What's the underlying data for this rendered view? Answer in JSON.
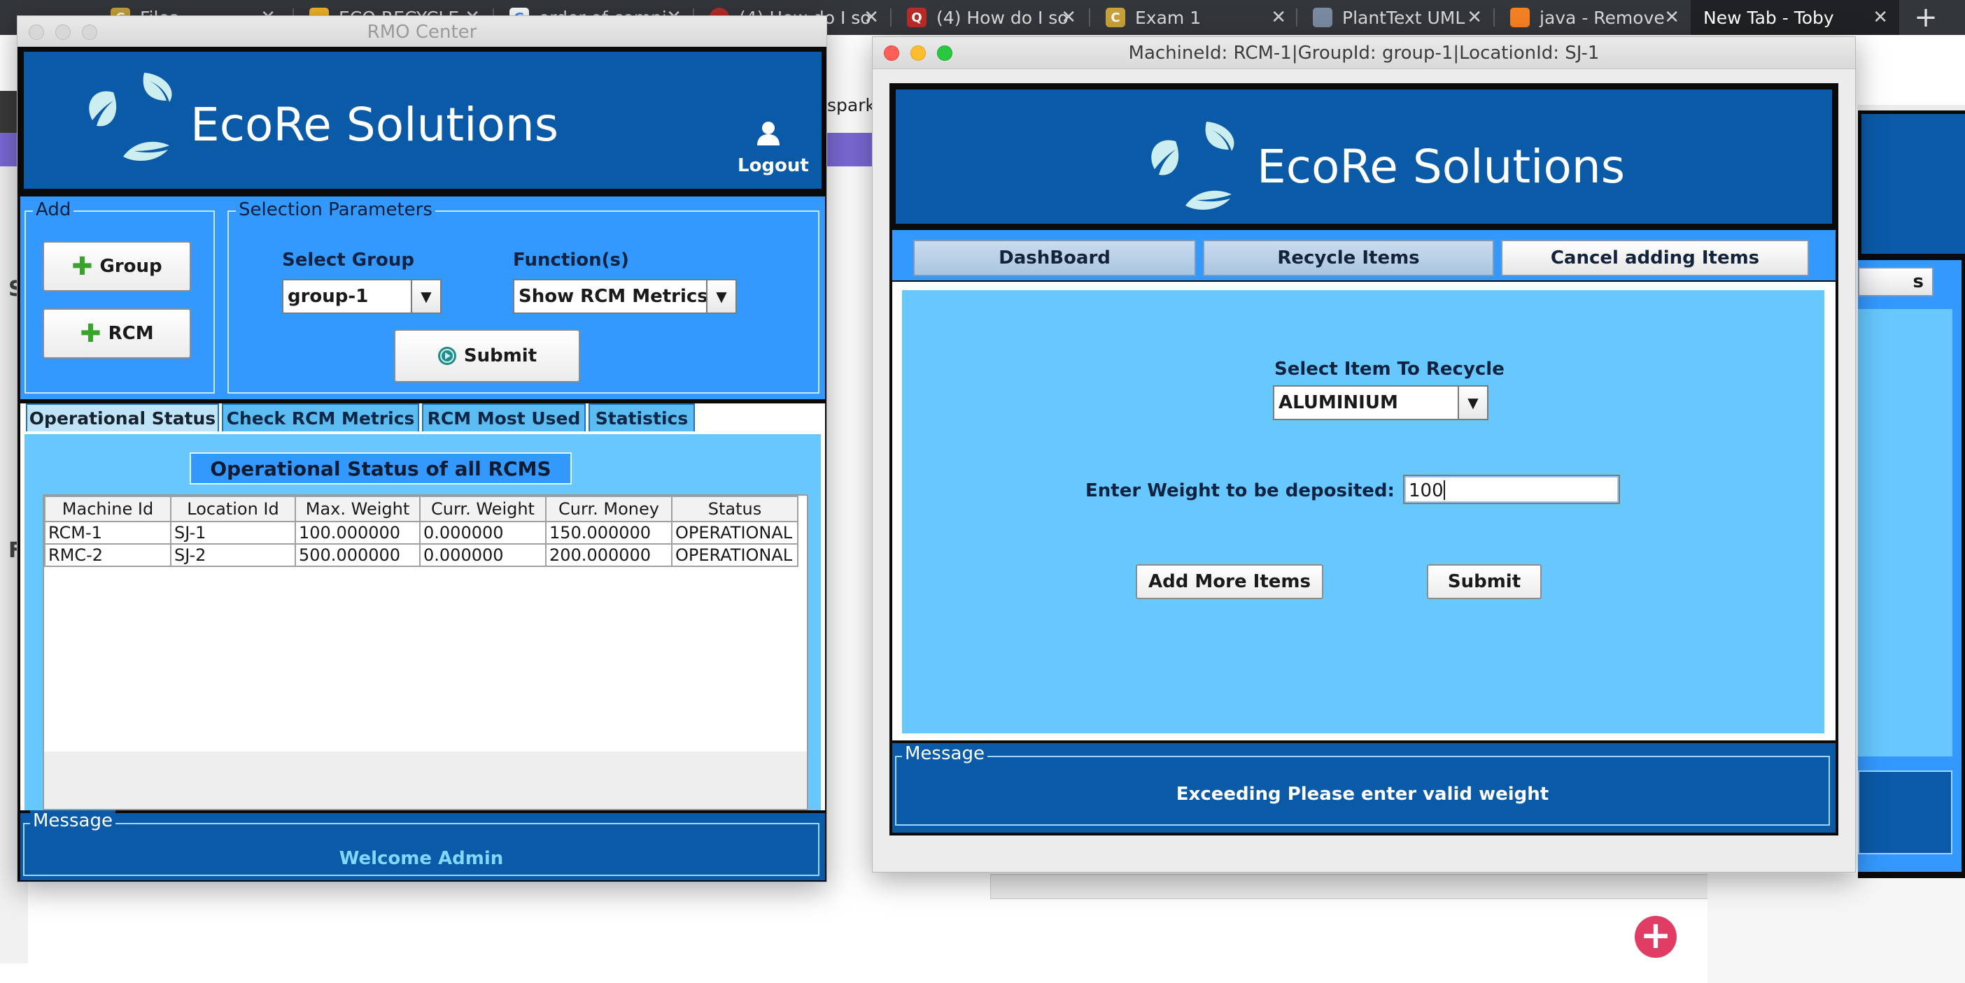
{
  "browser": {
    "tabs": [
      {
        "label": "Files",
        "fav": "C",
        "fav_color": "#c8a13b"
      },
      {
        "label": "ECO RECYCLE",
        "fav": "",
        "fav_color": "#f0b429"
      },
      {
        "label": "order of compi",
        "fav": "G",
        "fav_color": "#ffffff"
      },
      {
        "label": "(4) How do I so",
        "fav": "",
        "fav_color": "#b92b27"
      },
      {
        "label": "(4) How do I so",
        "fav": "Q",
        "fav_color": "#b92b27"
      },
      {
        "label": "Exam 1",
        "fav": "C",
        "fav_color": "#c8a13b"
      },
      {
        "label": "PlantText UML",
        "fav": "",
        "fav_color": "#7a8aa0"
      },
      {
        "label": "java - Remove",
        "fav": "",
        "fav_color": "#f48024"
      },
      {
        "label": "New Tab - Toby",
        "fav": "",
        "fav_color": ""
      }
    ],
    "bg_url_fragment": "sparkj"
  },
  "rmo": {
    "window_title": "RMO Center",
    "brand": "EcoRe Solutions",
    "logout_label": "Logout",
    "add_title": "Add",
    "add_group_label": "Group",
    "add_rcm_label": "RCM",
    "selection_title": "Selection Parameters",
    "select_group_label": "Select Group",
    "group_value": "group-1",
    "functions_label": "Function(s)",
    "function_value": "Show RCM Metrics",
    "submit_label": "Submit",
    "tabs": [
      "Operational Status",
      "Check RCM Metrics",
      "RCM Most Used",
      "Statistics"
    ],
    "table_title": "Operational Status of all RCMS",
    "columns": [
      "Machine Id",
      "Location Id",
      "Max. Weight",
      "Curr. Weight",
      "Curr. Money",
      "Status"
    ],
    "rows": [
      [
        "RCM-1",
        "SJ-1",
        "100.000000",
        "0.000000",
        "150.000000",
        "OPERATIONAL"
      ],
      [
        "RMC-2",
        "SJ-2",
        "500.000000",
        "0.000000",
        "200.000000",
        "OPERATIONAL"
      ]
    ],
    "message_title": "Message",
    "message_text": "Welcome Admin"
  },
  "rcm": {
    "window_title": "MachineId: RCM-1|GroupId: group-1|LocationId: SJ-1",
    "brand": "EcoRe Solutions",
    "nav": [
      "DashBoard",
      "Recycle Items",
      "Cancel adding Items"
    ],
    "select_item_label": "Select Item To Recycle",
    "item_value": "ALUMINIUM",
    "weight_label": "Enter Weight to be deposited:",
    "weight_value": "100",
    "add_more_label": "Add More Items",
    "submit_label": "Submit",
    "message_title": "Message",
    "message_text": "Exceeding Please enter valid weight"
  },
  "colors": {
    "header_blue": "#0b5aa8",
    "mid_blue": "#3399ff",
    "light_blue": "#66c8ff",
    "welcome_text": "#7fd8ff",
    "fab": "#e03c64"
  }
}
